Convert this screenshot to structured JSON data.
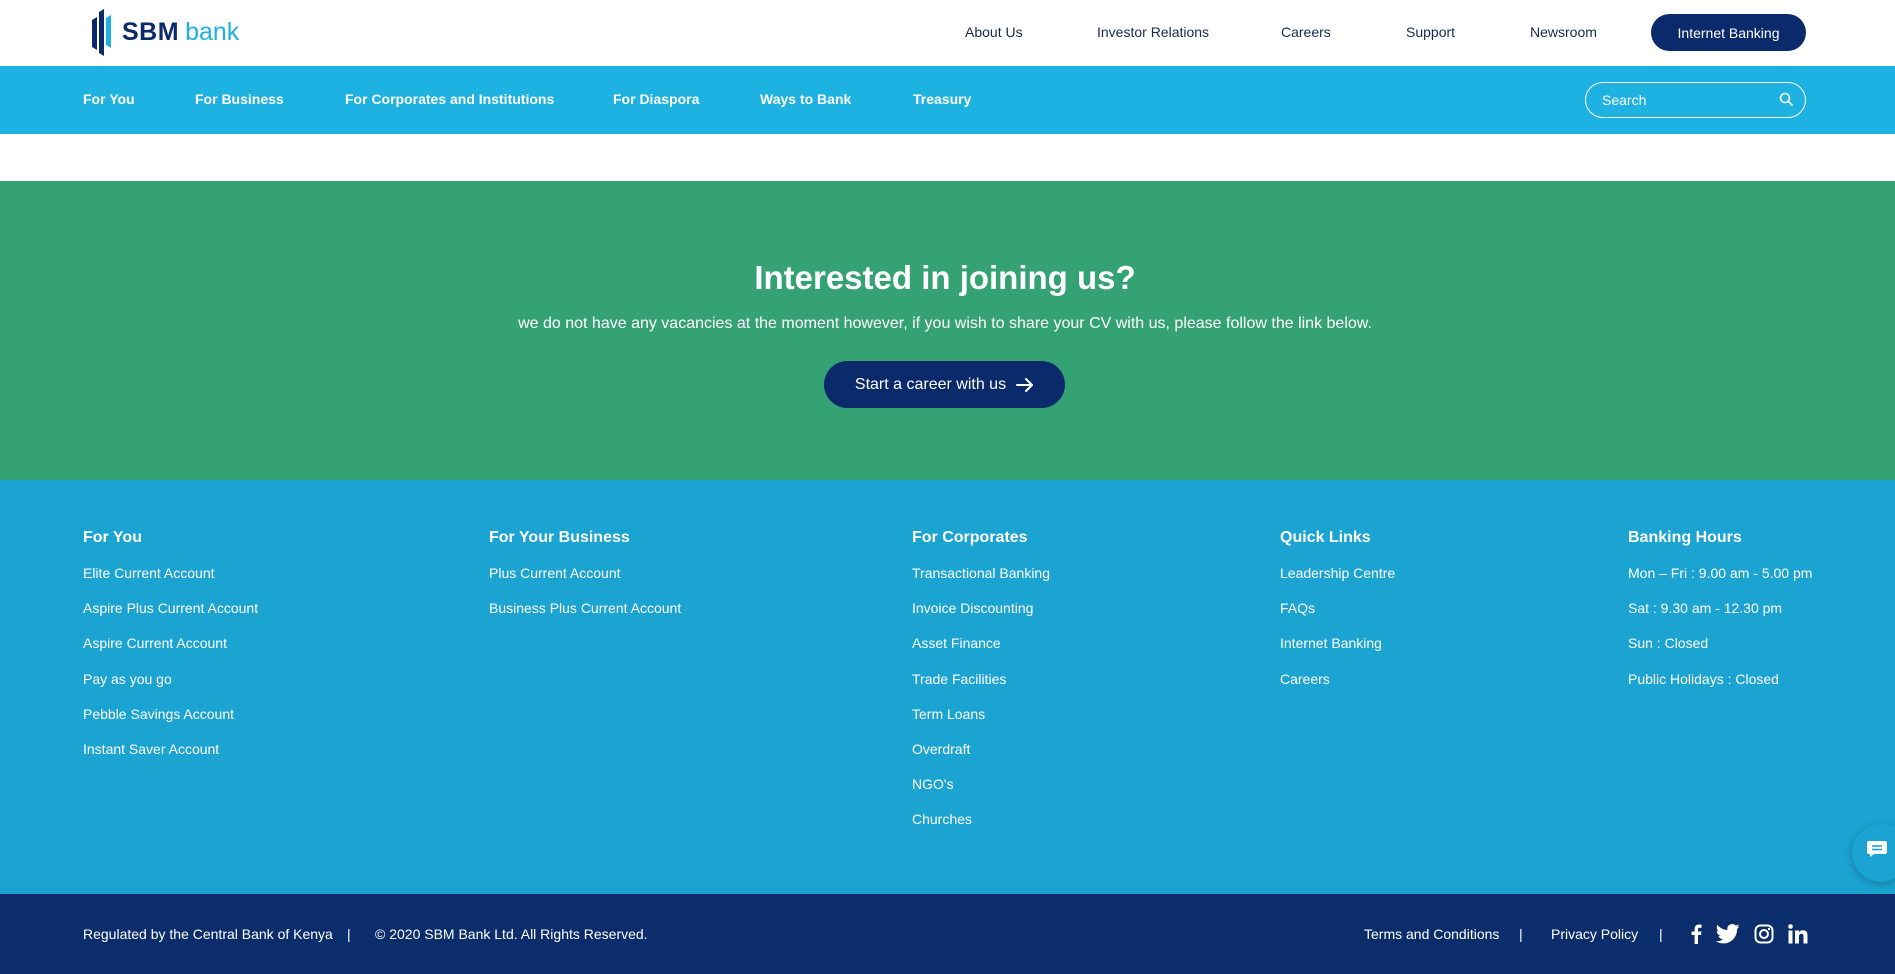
{
  "brand": {
    "name_bold": "SBM",
    "name_light": "bank",
    "colors": {
      "navy": "#0a2a6b",
      "sky": "#1db2e2",
      "green": "#35a274",
      "footer": "#1ba3d2"
    }
  },
  "topnav": {
    "items": [
      "About Us",
      "Investor Relations",
      "Careers",
      "Support",
      "Newsroom"
    ],
    "cta": "Internet Banking"
  },
  "mainnav": {
    "items": [
      "For You",
      "For Business",
      "For Corporates and Institutions",
      "For Diaspora",
      "Ways to Bank",
      "Treasury"
    ],
    "search_placeholder": "Search"
  },
  "career": {
    "title": "Interested in joining us?",
    "text": "we do not have any vacancies at the moment however, if you wish to share your CV with us, please follow the link below.",
    "button": "Start a career with us"
  },
  "footer": {
    "columns": [
      {
        "title": "For You",
        "links": [
          "Elite Current Account",
          "Aspire Plus Current Account",
          "Aspire Current Account",
          "Pay as you go",
          "Pebble Savings Account",
          "Instant Saver Account"
        ]
      },
      {
        "title": "For Your Business",
        "links": [
          "Plus Current Account",
          "Business Plus Current Account"
        ]
      },
      {
        "title": "For Corporates",
        "links": [
          "Transactional Banking",
          "Invoice Discounting",
          "Asset Finance",
          "Trade Facilities",
          "Term Loans",
          "Overdraft",
          "NGO's",
          "Churches"
        ]
      },
      {
        "title": "Quick Links",
        "links": [
          "Leadership Centre",
          "FAQs",
          "Internet Banking",
          "Careers"
        ]
      },
      {
        "title": "Banking Hours",
        "links": [
          "Mon – Fri : 9.00 am - 5.00 pm",
          "Sat : 9.30 am - 12.30 pm",
          "Sun : Closed",
          "Public Holidays : Closed"
        ]
      }
    ]
  },
  "bottombar": {
    "regulated": "Regulated by the Central Bank of Kenya",
    "separator": "|",
    "copyright": "© 2020 SBM Bank Ltd. All Rights Reserved.",
    "terms": "Terms and Conditions",
    "privacy": "Privacy Policy",
    "social_icons": [
      "facebook-icon",
      "twitter-icon",
      "instagram-icon",
      "linkedin-icon"
    ]
  }
}
